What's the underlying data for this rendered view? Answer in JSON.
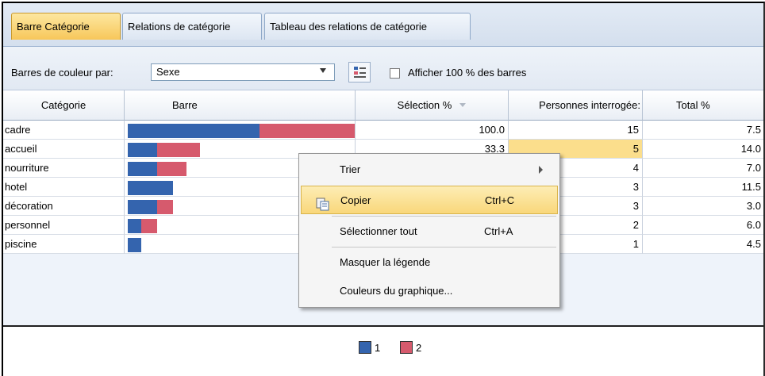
{
  "tabs": [
    {
      "label": "Barre Catégorie",
      "active": true
    },
    {
      "label": "Relations de catégorie",
      "active": false
    },
    {
      "label": "Tableau des relations de catégorie",
      "active": false
    }
  ],
  "toolbar": {
    "color_by_label": "Barres de couleur par:",
    "color_by_value": "Sexe",
    "show_100_label": "Afficher 100 % des barres",
    "show_100_checked": false
  },
  "table": {
    "headers": [
      "Catégorie",
      "Barre",
      "Sélection %",
      "Personnes interrogées",
      "Total %"
    ],
    "header_visible": [
      "Catégorie",
      "Barre",
      "Sélection %",
      "Personnes interrogée:",
      "Total %"
    ],
    "rows": [
      {
        "category": "cadre",
        "selection": "100.0",
        "respondents": "15",
        "total": "7.5",
        "bar1": 0.58,
        "bar2": 0.42
      },
      {
        "category": "accueil",
        "selection": "33.3",
        "respondents": "5",
        "total": "14.0",
        "bar1": 0.13,
        "bar2": 0.19
      },
      {
        "category": "nourriture",
        "selection": "",
        "respondents": "4",
        "total": "7.0",
        "bar1": 0.13,
        "bar2": 0.13
      },
      {
        "category": "hotel",
        "selection": "",
        "respondents": "3",
        "total": "11.5",
        "bar1": 0.2,
        "bar2": 0.0
      },
      {
        "category": "décoration",
        "selection": "",
        "respondents": "3",
        "total": "3.0",
        "bar1": 0.13,
        "bar2": 0.07
      },
      {
        "category": "personnel",
        "selection": "",
        "respondents": "2",
        "total": "6.0",
        "bar1": 0.06,
        "bar2": 0.07
      },
      {
        "category": "piscine",
        "selection": "",
        "respondents": "1",
        "total": "4.5",
        "bar1": 0.06,
        "bar2": 0.0
      }
    ]
  },
  "legend": [
    {
      "label": "1",
      "color": "#3464ae"
    },
    {
      "label": "2",
      "color": "#d65a6d"
    }
  ],
  "context_menu": {
    "items": [
      {
        "label": "Trier",
        "shortcut": "",
        "submenu": true,
        "selected": false
      },
      {
        "label": "Copier",
        "shortcut": "Ctrl+C",
        "submenu": false,
        "selected": true,
        "icon": "copy-icon"
      },
      {
        "label": "Sélectionner tout",
        "shortcut": "Ctrl+A",
        "submenu": false,
        "selected": false
      },
      {
        "label": "Masquer la légende",
        "shortcut": "",
        "submenu": false,
        "selected": false
      },
      {
        "label": "Couleurs du graphique...",
        "shortcut": "",
        "submenu": false,
        "selected": false
      }
    ]
  },
  "colors": {
    "series1": "#3464ae",
    "series2": "#d65a6d",
    "highlight": "#fbde8c",
    "active_tab": "#f7c75a"
  }
}
